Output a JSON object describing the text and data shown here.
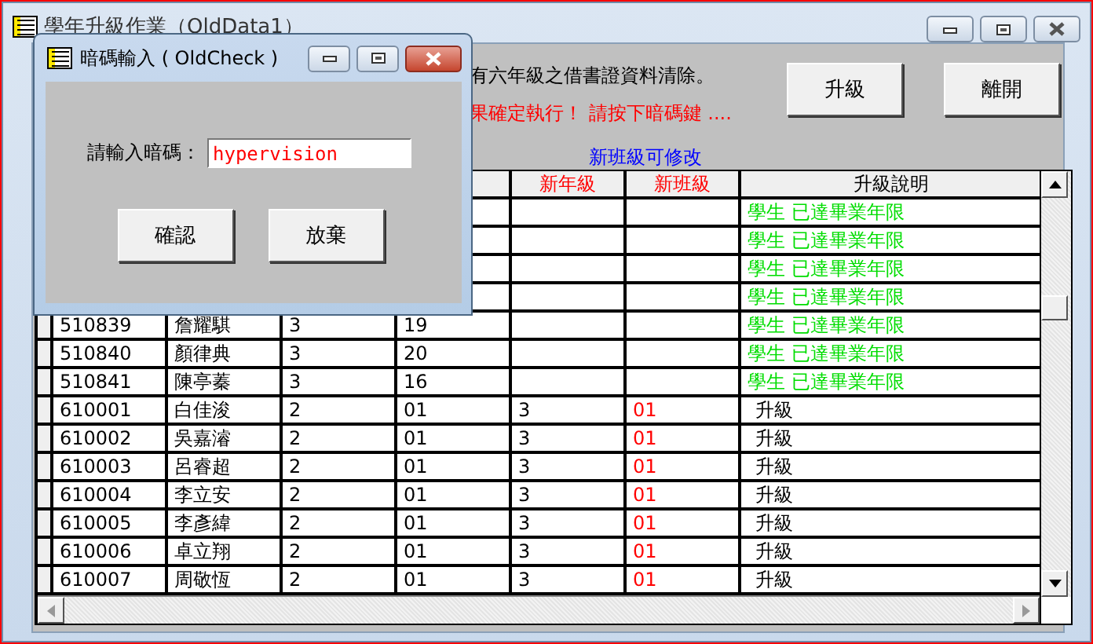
{
  "main_window": {
    "title": "學年升級作業（OldData1）"
  },
  "notice": {
    "line_1": "有六年級之借書證資料清除。",
    "line_2": "果確定執行！  請按下暗碼鍵  ....",
    "hint": "新班級可修改"
  },
  "buttons": [
    {
      "label": "升級"
    },
    {
      "label": "離開"
    }
  ],
  "table": {
    "columns": [
      {
        "label": "新年級",
        "kind": "new"
      },
      {
        "label": "新班級",
        "kind": "new"
      },
      {
        "label": "升級說明",
        "kind": "plain"
      }
    ],
    "rows": [
      {
        "note": "學生  已達畢業年限",
        "kind": "graduated"
      },
      {
        "note": "學生  已達畢業年限",
        "kind": "graduated"
      },
      {
        "note": "學生  已達畢業年限",
        "kind": "graduated"
      },
      {
        "note": "學生  已達畢業年限",
        "kind": "graduated"
      },
      {
        "student_id": "510839",
        "name": "詹耀騏",
        "grade": "3",
        "class": "19",
        "note": "學生  已達畢業年限",
        "kind": "graduated"
      },
      {
        "student_id": "510840",
        "name": "顏律典",
        "grade": "3",
        "class": "20",
        "note": "學生  已達畢業年限",
        "kind": "graduated"
      },
      {
        "student_id": "510841",
        "name": "陳亭蓁",
        "grade": "3",
        "class": "16",
        "note": "學生  已達畢業年限",
        "kind": "graduated"
      },
      {
        "student_id": "610001",
        "name": "白佳浚",
        "grade": "2",
        "class": "01",
        "new_grade": "3",
        "new_class": "01",
        "note": "升級",
        "kind": "promote"
      },
      {
        "student_id": "610002",
        "name": "吳嘉濬",
        "grade": "2",
        "class": "01",
        "new_grade": "3",
        "new_class": "01",
        "note": "升級",
        "kind": "promote"
      },
      {
        "student_id": "610003",
        "name": "呂睿超",
        "grade": "2",
        "class": "01",
        "new_grade": "3",
        "new_class": "01",
        "note": "升級",
        "kind": "promote"
      },
      {
        "student_id": "610004",
        "name": "李立安",
        "grade": "2",
        "class": "01",
        "new_grade": "3",
        "new_class": "01",
        "note": "升級",
        "kind": "promote"
      },
      {
        "student_id": "610005",
        "name": "李彥緯",
        "grade": "2",
        "class": "01",
        "new_grade": "3",
        "new_class": "01",
        "note": "升級",
        "kind": "promote"
      },
      {
        "student_id": "610006",
        "name": "卓立翔",
        "grade": "2",
        "class": "01",
        "new_grade": "3",
        "new_class": "01",
        "note": "升級",
        "kind": "promote"
      },
      {
        "student_id": "610007",
        "name": "周敬恆",
        "grade": "2",
        "class": "01",
        "new_grade": "3",
        "new_class": "01",
        "note": "升級",
        "kind": "promote"
      }
    ]
  },
  "dialog": {
    "title": "暗碼輸入 ( OldCheck )",
    "field_label": "請輸入暗碼：",
    "value": "hypervision",
    "buttons": [
      {
        "label": "確認"
      },
      {
        "label": "放棄"
      }
    ]
  }
}
